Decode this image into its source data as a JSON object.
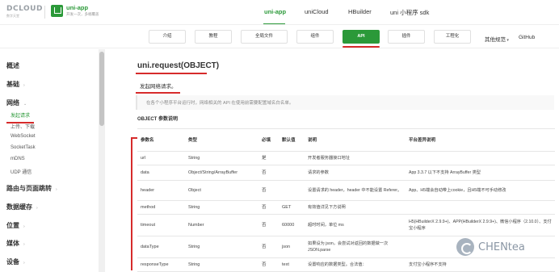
{
  "brand": {
    "dcloud_word": "DCLOUD",
    "dcloud_sub": "数字天堂",
    "app_name": "uni-app",
    "app_slogan": "开发一次，多端覆盖",
    "accent": "#2b9939"
  },
  "topnav": {
    "items": [
      {
        "label": "uni-app"
      },
      {
        "label": "uniCloud"
      },
      {
        "label": "HBuilder"
      },
      {
        "label": "uni 小程序 sdk"
      }
    ]
  },
  "subnav": {
    "buttons": [
      {
        "label": "介绍"
      },
      {
        "label": "教程"
      },
      {
        "label": "全局文件"
      },
      {
        "label": "组件"
      },
      {
        "label": "API"
      },
      {
        "label": "插件"
      },
      {
        "label": "工程化"
      }
    ],
    "other_specs": "其他规范",
    "github": "GitHub"
  },
  "sidebar": {
    "sections": [
      {
        "label": "概述"
      },
      {
        "label": "基础"
      },
      {
        "label": "网络"
      },
      {
        "label": "路由与页面跳转"
      },
      {
        "label": "数据缓存"
      },
      {
        "label": "位置"
      },
      {
        "label": "媒体"
      },
      {
        "label": "设备"
      }
    ],
    "network_items": [
      {
        "label": "发起请求"
      },
      {
        "label": "上传、下载"
      },
      {
        "label": "WebSocket"
      },
      {
        "label": "SocketTask"
      },
      {
        "label": "mDNS"
      },
      {
        "label": "UDP 通信"
      }
    ]
  },
  "content": {
    "title": "uni.request(OBJECT)",
    "description": "发起网络请求。",
    "note": "在各个小程序平台运行时，网络相关的 API 在使用前需要配置域名白名单。",
    "section_title": "OBJECT 参数说明",
    "table": {
      "headers": [
        "参数名",
        "类型",
        "必填",
        "默认值",
        "说明",
        "平台差异说明"
      ],
      "rows": [
        [
          "url",
          "String",
          "是",
          "",
          "开发者服务器接口地址",
          ""
        ],
        [
          "data",
          "Object/String/ArrayBuffer",
          "否",
          "",
          "请求的参数",
          "App 3.3.7 以下不支持 ArrayBuffer 类型"
        ],
        [
          "header",
          "Object",
          "否",
          "",
          "设置请求的 header，header 中不能设置 Referer。",
          "App、H5端会自动带上cookie，且H5端不可手动修改"
        ],
        [
          "method",
          "String",
          "否",
          "GET",
          "有效值详见下方说明",
          ""
        ],
        [
          "timeout",
          "Number",
          "否",
          "60000",
          "超时时间，单位 ms",
          "H5(HBuilderX 2.9.9+)、APP(HBuilderX 2.9.9+)、微信小程序（2.10.0）、支付宝小程序"
        ],
        [
          "dataType",
          "String",
          "否",
          "json",
          "如果设为 json，会尝试对返回的数据做一次 JSON.parse",
          ""
        ],
        [
          "responseType",
          "String",
          "否",
          "text",
          "设置响应的数据类型。合法值：",
          "支付宝小程序不支持"
        ]
      ]
    }
  },
  "watermark": {
    "text": "CHENtea"
  }
}
